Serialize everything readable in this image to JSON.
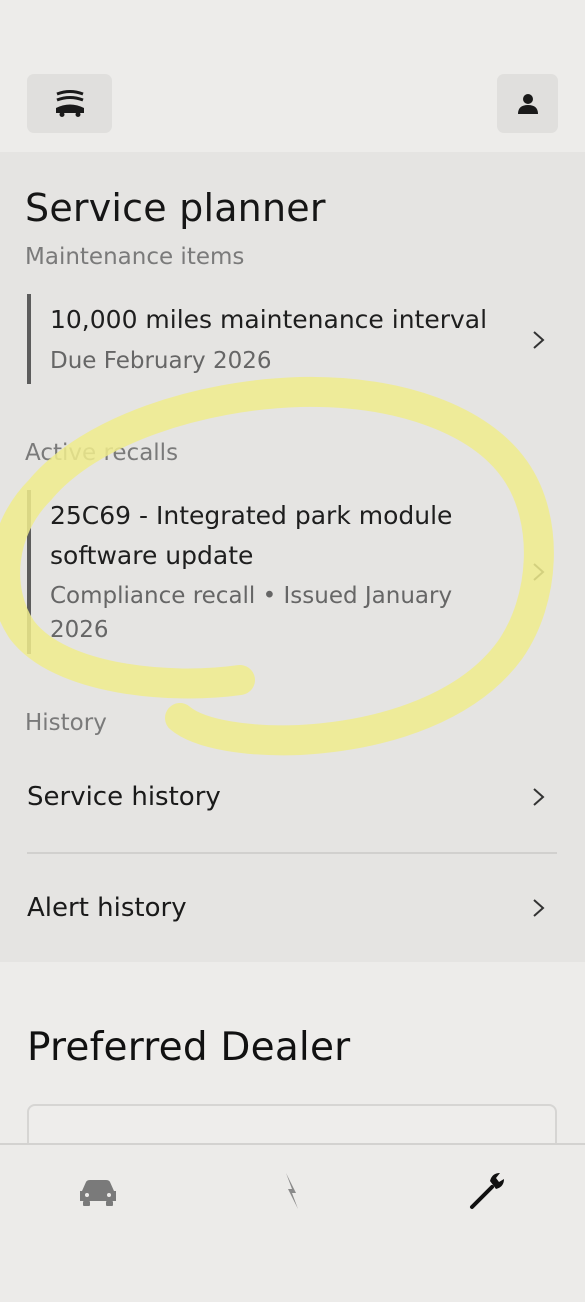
{
  "header": {
    "menu_icon": "vehicles-menu-icon",
    "profile_icon": "person-icon"
  },
  "service_planner": {
    "title": "Service planner",
    "maintenance_label": "Maintenance items",
    "maintenance_item": {
      "title": "10,000 miles maintenance interval",
      "subtitle": "Due February 2026"
    },
    "recalls_label": "Active recalls",
    "recall_item": {
      "title_line1": "25C69 - Integrated park module",
      "title_line2": "software update",
      "subtitle_line1": "Compliance recall • Issued January",
      "subtitle_line2": "2026"
    },
    "history_label": "History",
    "history_items": [
      {
        "label": "Service history"
      },
      {
        "label": "Alert history"
      }
    ]
  },
  "dealer": {
    "title": "Preferred Dealer"
  },
  "bottom_nav": {
    "items": [
      {
        "icon": "car-icon",
        "active": false
      },
      {
        "icon": "lightning-icon",
        "active": false
      },
      {
        "icon": "wrench-icon",
        "active": true
      }
    ]
  },
  "colors": {
    "highlight": "#f0ec8c",
    "accent_border": "#5c5c5c",
    "panel_bg": "#e5e4e2"
  }
}
